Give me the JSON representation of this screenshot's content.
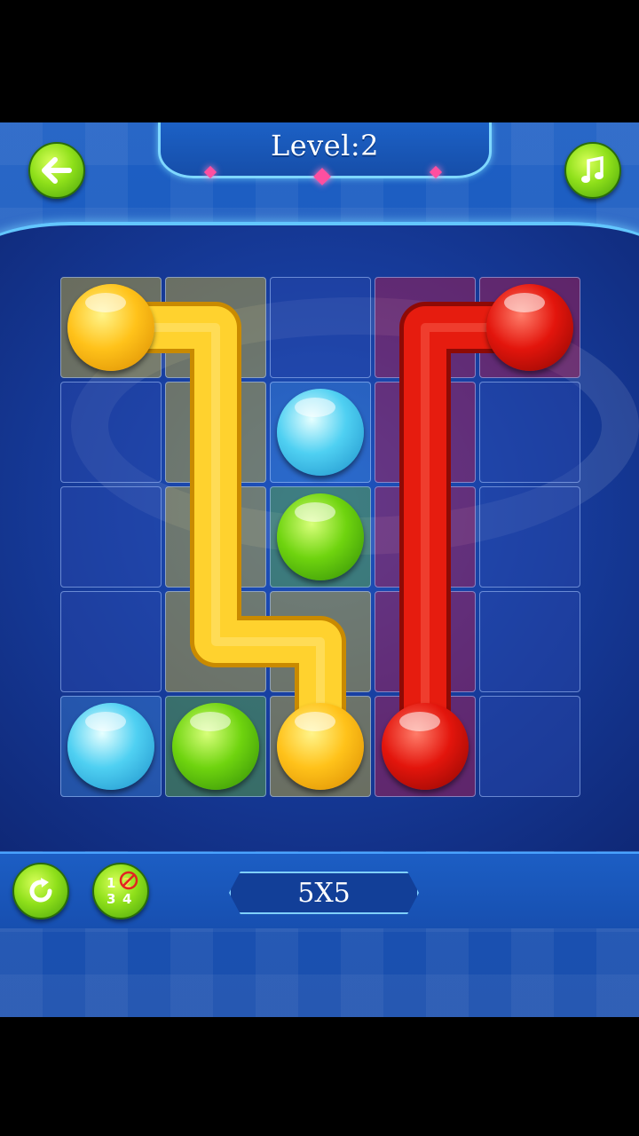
{
  "header": {
    "level_label": "Level:2"
  },
  "buttons": {
    "back": {
      "icon": "arrow-left-icon"
    },
    "music": {
      "icon": "music-note-icon"
    },
    "restart": {
      "icon": "restart-icon"
    },
    "hint": {
      "icon": "hint-numbers-icon",
      "digits": [
        "1",
        "2",
        "3",
        "4"
      ]
    }
  },
  "board": {
    "size_label": "5X5",
    "rows": 5,
    "cols": 5,
    "colors": {
      "yellow": "#ffc21a",
      "red": "#e3150c",
      "cyan": "#4fd0f2",
      "green": "#6fd40f"
    },
    "balls": [
      {
        "color": "yellow",
        "row": 0,
        "col": 0
      },
      {
        "color": "red",
        "row": 0,
        "col": 4
      },
      {
        "color": "cyan",
        "row": 1,
        "col": 2
      },
      {
        "color": "green",
        "row": 2,
        "col": 2
      },
      {
        "color": "cyan",
        "row": 4,
        "col": 0
      },
      {
        "color": "green",
        "row": 4,
        "col": 1
      },
      {
        "color": "yellow",
        "row": 4,
        "col": 2
      },
      {
        "color": "red",
        "row": 4,
        "col": 3
      }
    ],
    "paths": [
      {
        "color": "yellow",
        "cells": [
          [
            0,
            0
          ],
          [
            0,
            1
          ],
          [
            1,
            1
          ],
          [
            2,
            1
          ],
          [
            3,
            1
          ],
          [
            3,
            2
          ],
          [
            4,
            2
          ]
        ]
      },
      {
        "color": "red",
        "cells": [
          [
            0,
            4
          ],
          [
            0,
            3
          ],
          [
            1,
            3
          ],
          [
            2,
            3
          ],
          [
            3,
            3
          ],
          [
            4,
            3
          ]
        ]
      }
    ]
  }
}
